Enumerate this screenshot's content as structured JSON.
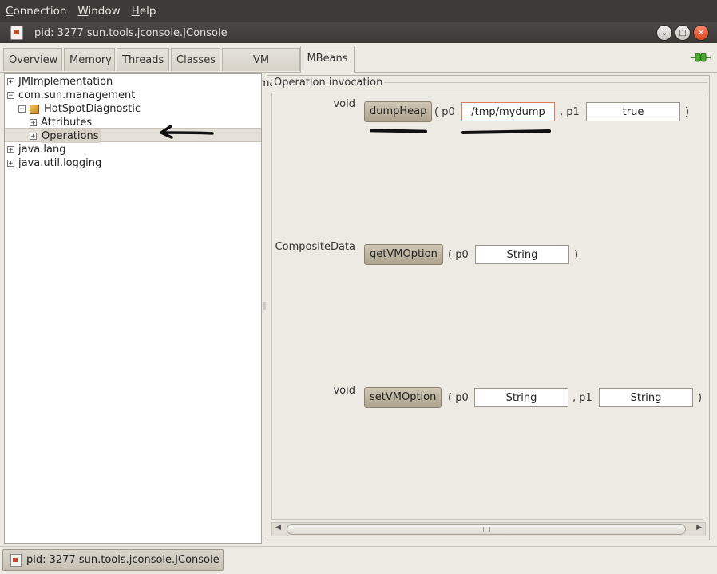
{
  "menubar": {
    "items": [
      {
        "first": "C",
        "rest": "onnection"
      },
      {
        "first": "W",
        "rest": "indow"
      },
      {
        "first": "H",
        "rest": "elp"
      }
    ]
  },
  "window": {
    "title": "pid: 3277 sun.tools.jconsole.JConsole",
    "buttons": {
      "minimize": "⌄",
      "maximize": "□",
      "close": "✕"
    }
  },
  "tabs": [
    "Overview",
    "Memory",
    "Threads",
    "Classes",
    "VM Summary",
    "MBeans"
  ],
  "active_tab": "MBeans",
  "tree": {
    "nodes": [
      {
        "label": "JMImplementation",
        "toggle": "+"
      },
      {
        "label": "com.sun.management",
        "toggle": "−"
      },
      {
        "label": "HotSpotDiagnostic",
        "toggle": "−"
      },
      {
        "label": "Attributes",
        "toggle": "+"
      },
      {
        "label": "Operations",
        "toggle": "+"
      },
      {
        "label": "java.lang",
        "toggle": "+"
      },
      {
        "label": "java.util.logging",
        "toggle": "+"
      }
    ]
  },
  "operations": {
    "group_title": "Operation invocation",
    "items": [
      {
        "return_type": "void",
        "name": "dumpHeap",
        "open": "( p0",
        "p0": "/tmp/mydump",
        "sep": ", p1",
        "p1": "true",
        "close": ")"
      },
      {
        "return_type": "CompositeData",
        "name": "getVMOption",
        "open": "( p0",
        "p0": "String",
        "close": ")"
      },
      {
        "return_type": "void",
        "name": "setVMOption",
        "open": "( p0",
        "p0": "String",
        "sep": ", p1",
        "p1": "String",
        "close": ")"
      }
    ]
  },
  "scroll": {
    "left": "◀",
    "right": "▶"
  },
  "taskbar": {
    "label": "pid: 3277 sun.tools.jconsole.JConsole"
  }
}
